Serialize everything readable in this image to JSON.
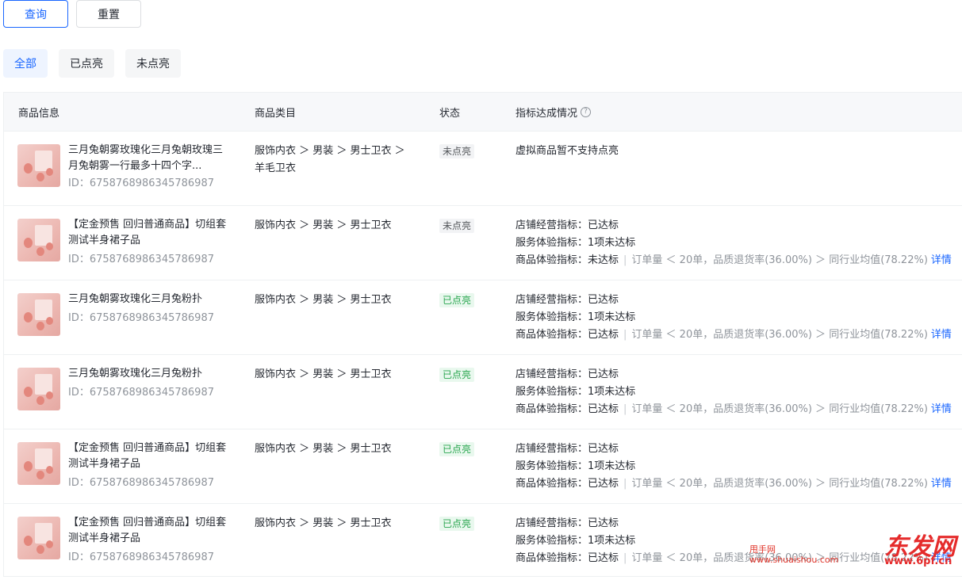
{
  "actions": {
    "query_label": "查询",
    "reset_label": "重置"
  },
  "filters": [
    {
      "label": "全部",
      "active": true
    },
    {
      "label": "已点亮",
      "active": false
    },
    {
      "label": "未点亮",
      "active": false
    }
  ],
  "table": {
    "headers": {
      "info": "商品信息",
      "category": "商品类目",
      "status": "状态",
      "metric": "指标达成情况",
      "help_icon": "question-circle-icon"
    },
    "rows": [
      {
        "title": "三月兔朝雾玫瑰化三月兔朝玫瑰三月兔朝雾一行最多十四个字...",
        "id": "ID：6758768986345786987",
        "category": "服饰内衣 ＞ 男装 ＞ 男士卫衣 ＞ 羊毛卫衣",
        "status": "未点亮",
        "status_type": "off",
        "note": "虚拟商品暂不支持点亮"
      },
      {
        "title": "【定金预售 回归普通商品】切组套测试半身裙子品",
        "id": "ID：6758768986345786987",
        "category": "服饰内衣 ＞ 男装 ＞ 男士卫衣",
        "status": "未点亮",
        "status_type": "off",
        "m1": "店铺经营指标：已达标",
        "m2": "服务体验指标：1项未达标",
        "m3": "商品体验指标：未达标",
        "m3_detail": "订单量 ＜ 20单，品质退货率(36.00%) ＞ 同行业均值(78.22%)",
        "detail_label": "详情"
      },
      {
        "title": "三月兔朝雾玫瑰化三月兔粉扑",
        "id": "ID：6758768986345786987",
        "category": "服饰内衣 ＞ 男装 ＞ 男士卫衣",
        "status": "已点亮",
        "status_type": "on",
        "m1": "店铺经营指标：已达标",
        "m2": "服务体验指标：1项未达标",
        "m3": "商品体验指标：已达标",
        "m3_detail": "订单量 ＜ 20单，品质退货率(36.00%) ＞ 同行业均值(78.22%)",
        "detail_label": "详情"
      },
      {
        "title": "三月兔朝雾玫瑰化三月兔粉扑",
        "id": "ID：6758768986345786987",
        "category": "服饰内衣 ＞ 男装 ＞ 男士卫衣",
        "status": "已点亮",
        "status_type": "on",
        "m1": "店铺经营指标：已达标",
        "m2": "服务体验指标：1项未达标",
        "m3": "商品体验指标：已达标",
        "m3_detail": "订单量 ＜ 20单，品质退货率(36.00%) ＞ 同行业均值(78.22%)",
        "detail_label": "详情"
      },
      {
        "title": "【定金预售 回归普通商品】切组套测试半身裙子品",
        "id": "ID：6758768986345786987",
        "category": "服饰内衣 ＞ 男装 ＞ 男士卫衣",
        "status": "已点亮",
        "status_type": "on",
        "m1": "店铺经营指标：已达标",
        "m2": "服务体验指标：1项未达标",
        "m3": "商品体验指标：已达标",
        "m3_detail": "订单量 ＜ 20单，品质退货率(36.00%) ＞ 同行业均值(78.22%)",
        "detail_label": "详情"
      },
      {
        "title": "【定金预售 回归普通商品】切组套测试半身裙子品",
        "id": "ID：6758768986345786987",
        "category": "服饰内衣 ＞ 男装 ＞ 男士卫衣",
        "status": "已点亮",
        "status_type": "on",
        "m1": "店铺经营指标：已达标",
        "m2": "服务体验指标：1项未达标",
        "m3": "商品体验指标：已达标",
        "m3_detail": "订单量 ＜ 20单，品质退货率(36.00%) ＞ 同行业均值(78.22%)",
        "detail_label": "详情"
      }
    ]
  },
  "watermark": {
    "small_text": "甩手网",
    "url_left": "www.shuaishou.com",
    "logo_text": "东发网",
    "url_right": "www.6pf.cn"
  },
  "colors": {
    "accent": "#1966ff",
    "lit": "#2aa650",
    "unlit": "#55585c"
  }
}
